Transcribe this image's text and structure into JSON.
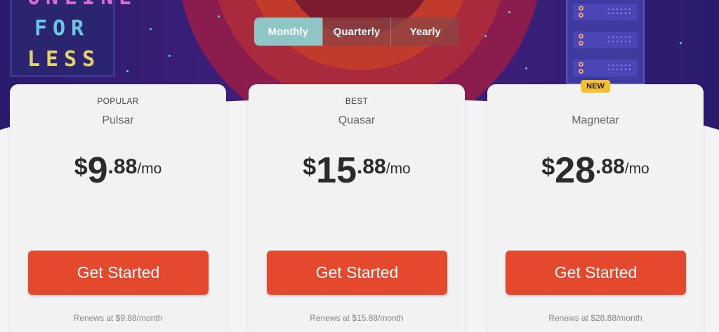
{
  "hero": {
    "board_lines": [
      "ONLINE",
      "FOR",
      "LESS"
    ]
  },
  "billing_toggle": {
    "options": [
      {
        "label": "Monthly",
        "active": true
      },
      {
        "label": "Quarterly",
        "active": false
      },
      {
        "label": "Yearly",
        "active": false
      }
    ]
  },
  "plans": [
    {
      "tag": "POPULAR",
      "name": "Pulsar",
      "currency": "$",
      "price_int": "9",
      "price_dec": ".88",
      "period": "/mo",
      "cta": "Get Started",
      "renew": "Renews at $9.88/month"
    },
    {
      "tag": "BEST",
      "name": "Quasar",
      "currency": "$",
      "price_int": "15",
      "price_dec": ".88",
      "period": "/mo",
      "cta": "Get Started",
      "renew": "Renews at $15.88/month"
    },
    {
      "badge": "NEW",
      "name": "Magnetar",
      "currency": "$",
      "price_int": "28",
      "price_dec": ".88",
      "period": "/mo",
      "cta": "Get Started",
      "renew": "Renews at $28.88/month"
    }
  ],
  "colors": {
    "accent_cta": "#e4492d",
    "toggle_active": "#8ec6c5",
    "badge_new": "#f6c02f"
  }
}
